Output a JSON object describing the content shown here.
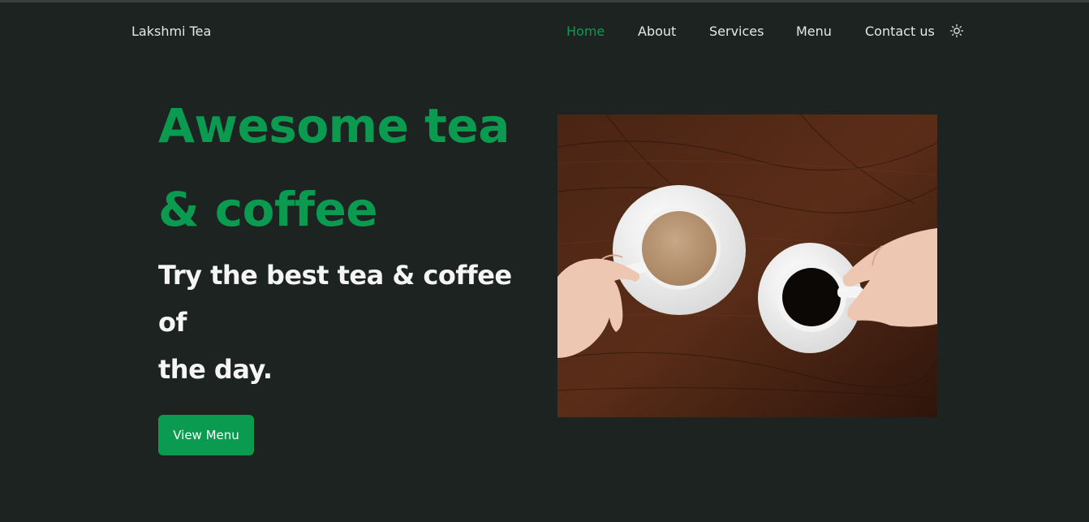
{
  "header": {
    "brand": "Lakshmi Tea",
    "nav": [
      {
        "label": "Home",
        "active": true
      },
      {
        "label": "About",
        "active": false
      },
      {
        "label": "Services",
        "active": false
      },
      {
        "label": "Menu",
        "active": false
      },
      {
        "label": "Contact us",
        "active": false
      }
    ],
    "theme_icon": "sun-icon"
  },
  "hero": {
    "title_line1": "Awesome tea",
    "title_line2": "& coffee",
    "subtitle_line1": "Try the best tea & coffee",
    "subtitle_line2": "of",
    "subtitle_line3": "the day.",
    "cta_label": "View Menu",
    "image_icon": "tea-and-coffee-cups-image"
  },
  "colors": {
    "background": "#1c2320",
    "accent": "#0a9b50",
    "text": "#e6e8e6"
  }
}
